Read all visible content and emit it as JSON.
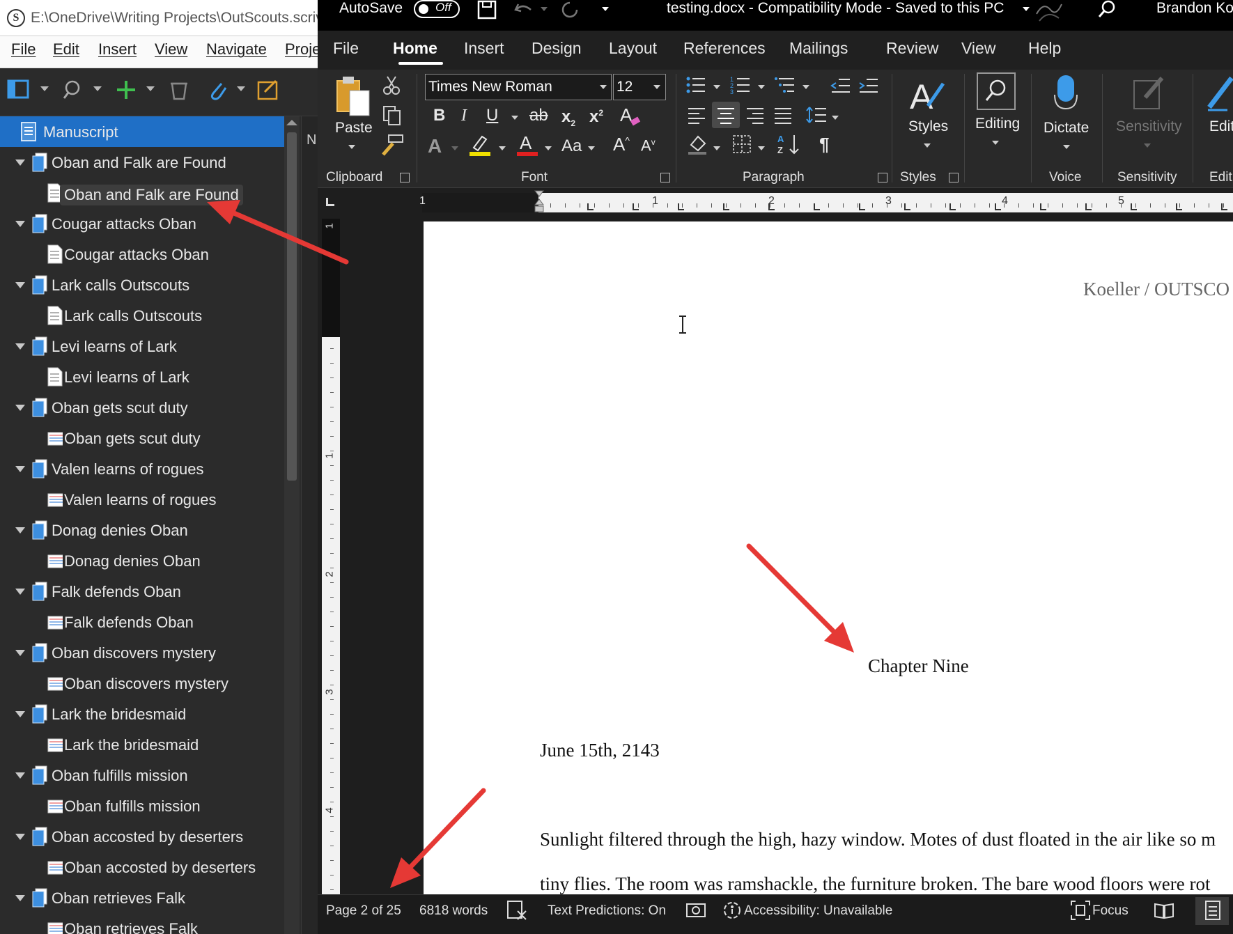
{
  "scrivener": {
    "title_path": "E:\\OneDrive\\Writing Projects\\OutScouts.scriv",
    "menu": [
      "File",
      "Edit",
      "Insert",
      "View",
      "Navigate",
      "Proje"
    ],
    "editor_tab_letter": "N",
    "binder": {
      "root": "Manuscript",
      "items": [
        {
          "folder": "Oban and Falk are Found",
          "doc": "Oban and Falk are Found"
        },
        {
          "folder": "Cougar attacks Oban",
          "doc": "Cougar attacks Oban"
        },
        {
          "folder": "Lark calls Outscouts",
          "doc": "Lark calls Outscouts"
        },
        {
          "folder": "Levi learns of Lark",
          "doc": "Levi learns of Lark"
        },
        {
          "folder": "Oban gets scut duty",
          "doc": "Oban gets scut duty"
        },
        {
          "folder": "Valen learns of rogues",
          "doc": "Valen learns of rogues"
        },
        {
          "folder": "Donag denies Oban",
          "doc": "Donag denies Oban"
        },
        {
          "folder": "Falk defends Oban",
          "doc": "Falk defends Oban"
        },
        {
          "folder": "Oban discovers mystery",
          "doc": "Oban discovers mystery"
        },
        {
          "folder": "Lark the bridesmaid",
          "doc": "Lark the bridesmaid"
        },
        {
          "folder": "Oban fulfills mission",
          "doc": "Oban fulfills mission"
        },
        {
          "folder": "Oban accosted by deserters",
          "doc": "Oban accosted by deserters"
        },
        {
          "folder": "Oban retrieves Falk",
          "doc": "Oban retrieves Falk"
        }
      ]
    }
  },
  "word": {
    "title_bar": {
      "autosave_label": "AutoSave",
      "autosave_state": "Off",
      "document": "testing.docx  -  Compatibility Mode  -  Saved to this PC",
      "user": "Brandon Ko"
    },
    "tabs": [
      "File",
      "Home",
      "Insert",
      "Design",
      "Layout",
      "References",
      "Mailings",
      "Review",
      "View",
      "Help"
    ],
    "active_tab": "Home",
    "ribbon": {
      "paste_label": "Paste",
      "font_name": "Times New Roman",
      "font_size": "12",
      "change_case": "Aa",
      "styles_label": "Styles",
      "editing_label": "Editing",
      "dictate_label": "Dictate",
      "sensitivity_label": "Sensitivity",
      "editor_label": "Edit",
      "groups": {
        "clipboard": "Clipboard",
        "font": "Font",
        "paragraph": "Paragraph",
        "styles": "Styles",
        "voice": "Voice",
        "sensitivity": "Sensitivity",
        "editor": "Edit"
      }
    },
    "ruler_numbers": [
      "1",
      "1",
      "2",
      "3",
      "4",
      "5"
    ],
    "vruler_numbers": [
      "1",
      "1",
      "2",
      "3",
      "4"
    ],
    "document": {
      "header": "Koeller / OUTSCO",
      "chapter_title": "Chapter Nine",
      "date_line": "June 15th, 2143",
      "body_lines": [
        "Sunlight filtered through the high, hazy window. Motes of dust floated in the air like so m",
        "tiny flies. The room was ramshackle, the furniture broken. The bare wood floors were rot"
      ]
    },
    "status_bar": {
      "page": "Page 2 of 25",
      "words": "6818 words",
      "text_predictions": "Text Predictions: On",
      "accessibility": "Accessibility: Unavailable",
      "focus": "Focus"
    }
  },
  "colors": {
    "selection_blue": "#1f6fc6",
    "annotation_arrow": "#e53935",
    "word_titlebar": "#000000",
    "ribbon_bg": "#292929"
  }
}
